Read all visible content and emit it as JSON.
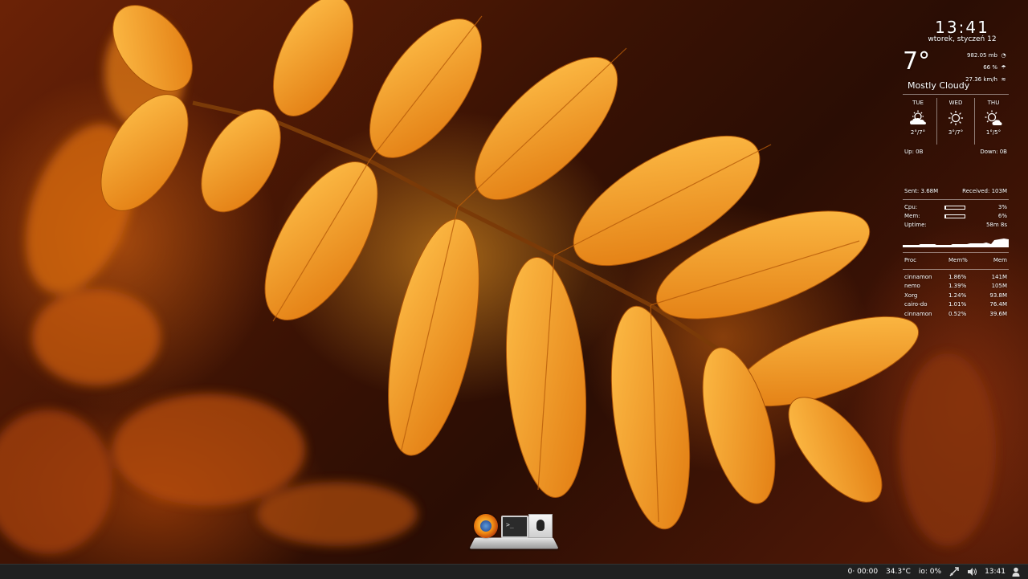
{
  "clock": {
    "time": "13:41",
    "date": "wtorek, styczeń 12"
  },
  "weather": {
    "temp": "7°",
    "pressure": "982.05 mb",
    "humidity": "66 %",
    "wind": "27.36 km/h",
    "condition": "Mostly Cloudy",
    "forecast": [
      {
        "day": "TUE",
        "range": "2°/7°",
        "icon": "partly-cloudy-icon"
      },
      {
        "day": "WED",
        "range": "3°/7°",
        "icon": "sun-icon"
      },
      {
        "day": "THU",
        "range": "1°/5°",
        "icon": "sun-cloud-icon"
      }
    ]
  },
  "network": {
    "up": "Up: 0B",
    "down": "Down: 0B",
    "sent": "Sent: 3.68M",
    "received": "Received: 103M"
  },
  "system": {
    "cpu_label": "Cpu:",
    "cpu_value": "3%",
    "cpu_fraction": 0.03,
    "mem_label": "Mem:",
    "mem_value": "6%",
    "mem_fraction": 0.06,
    "uptime_label": "Uptime:",
    "uptime_value": "58m 8s"
  },
  "processes": {
    "headers": [
      "Proc",
      "Mem%",
      "Mem"
    ],
    "rows": [
      [
        "cinnamon",
        "1.86%",
        "141M"
      ],
      [
        "nemo",
        "1.39%",
        "105M"
      ],
      [
        "Xorg",
        "1.24%",
        "93.8M"
      ],
      [
        "cairo-do",
        "1.01%",
        "76.4M"
      ],
      [
        "cinnamon",
        "0.52%",
        "39.6M"
      ]
    ]
  },
  "dock": {
    "items": [
      "firefox-icon",
      "terminal-icon",
      "tux-icon"
    ]
  },
  "taskbar": {
    "status1": "0· 00:00",
    "temperature": "34.3°C",
    "io": "io: 0%",
    "time": "13:41"
  }
}
